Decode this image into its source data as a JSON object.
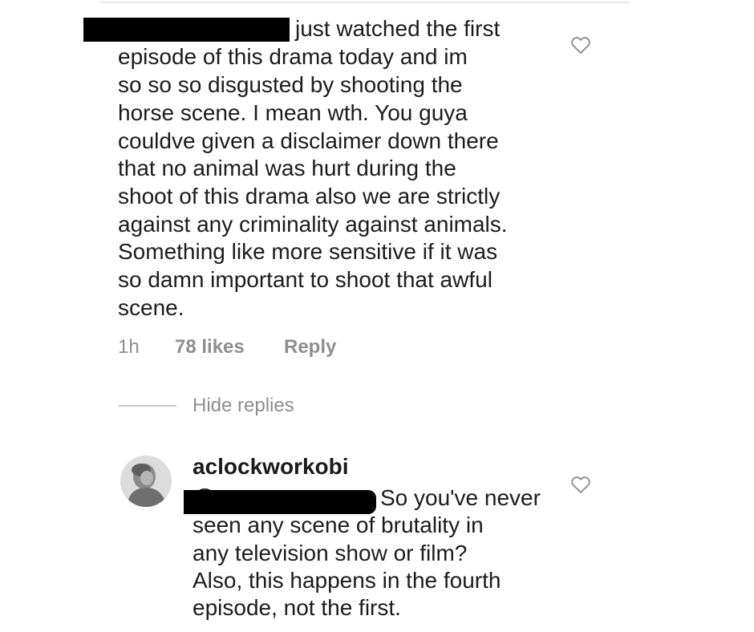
{
  "parent_comment": {
    "lines": [
      "just watched the first",
      "episode of this drama today and im",
      "so so so disgusted by shooting the",
      "horse scene. I mean wth. You guya",
      "couldve given a disclaimer down there",
      "that no animal was hurt during the",
      "shoot of this drama also we are strictly",
      "against any criminality against animals.",
      "Something like more sensitive if it was",
      "so damn important to shoot that awful",
      "scene."
    ],
    "time": "1h",
    "likes": "78 likes",
    "reply_label": "Reply"
  },
  "thread": {
    "hide_replies_label": "Hide replies"
  },
  "reply_comment": {
    "username": "aclockworkobi",
    "mention_visible_fragment": "@",
    "lines": [
      "So you've never",
      "seen any scene of brutality in",
      "any television show or film?",
      "Also, this happens in the fourth",
      "episode, not the first."
    ]
  },
  "icons": {
    "like": "heart-outline-icon",
    "avatar": "profile-photo"
  },
  "colors": {
    "text": "#1c1c1c",
    "meta": "#8e8e8e",
    "redaction": "#000000"
  }
}
